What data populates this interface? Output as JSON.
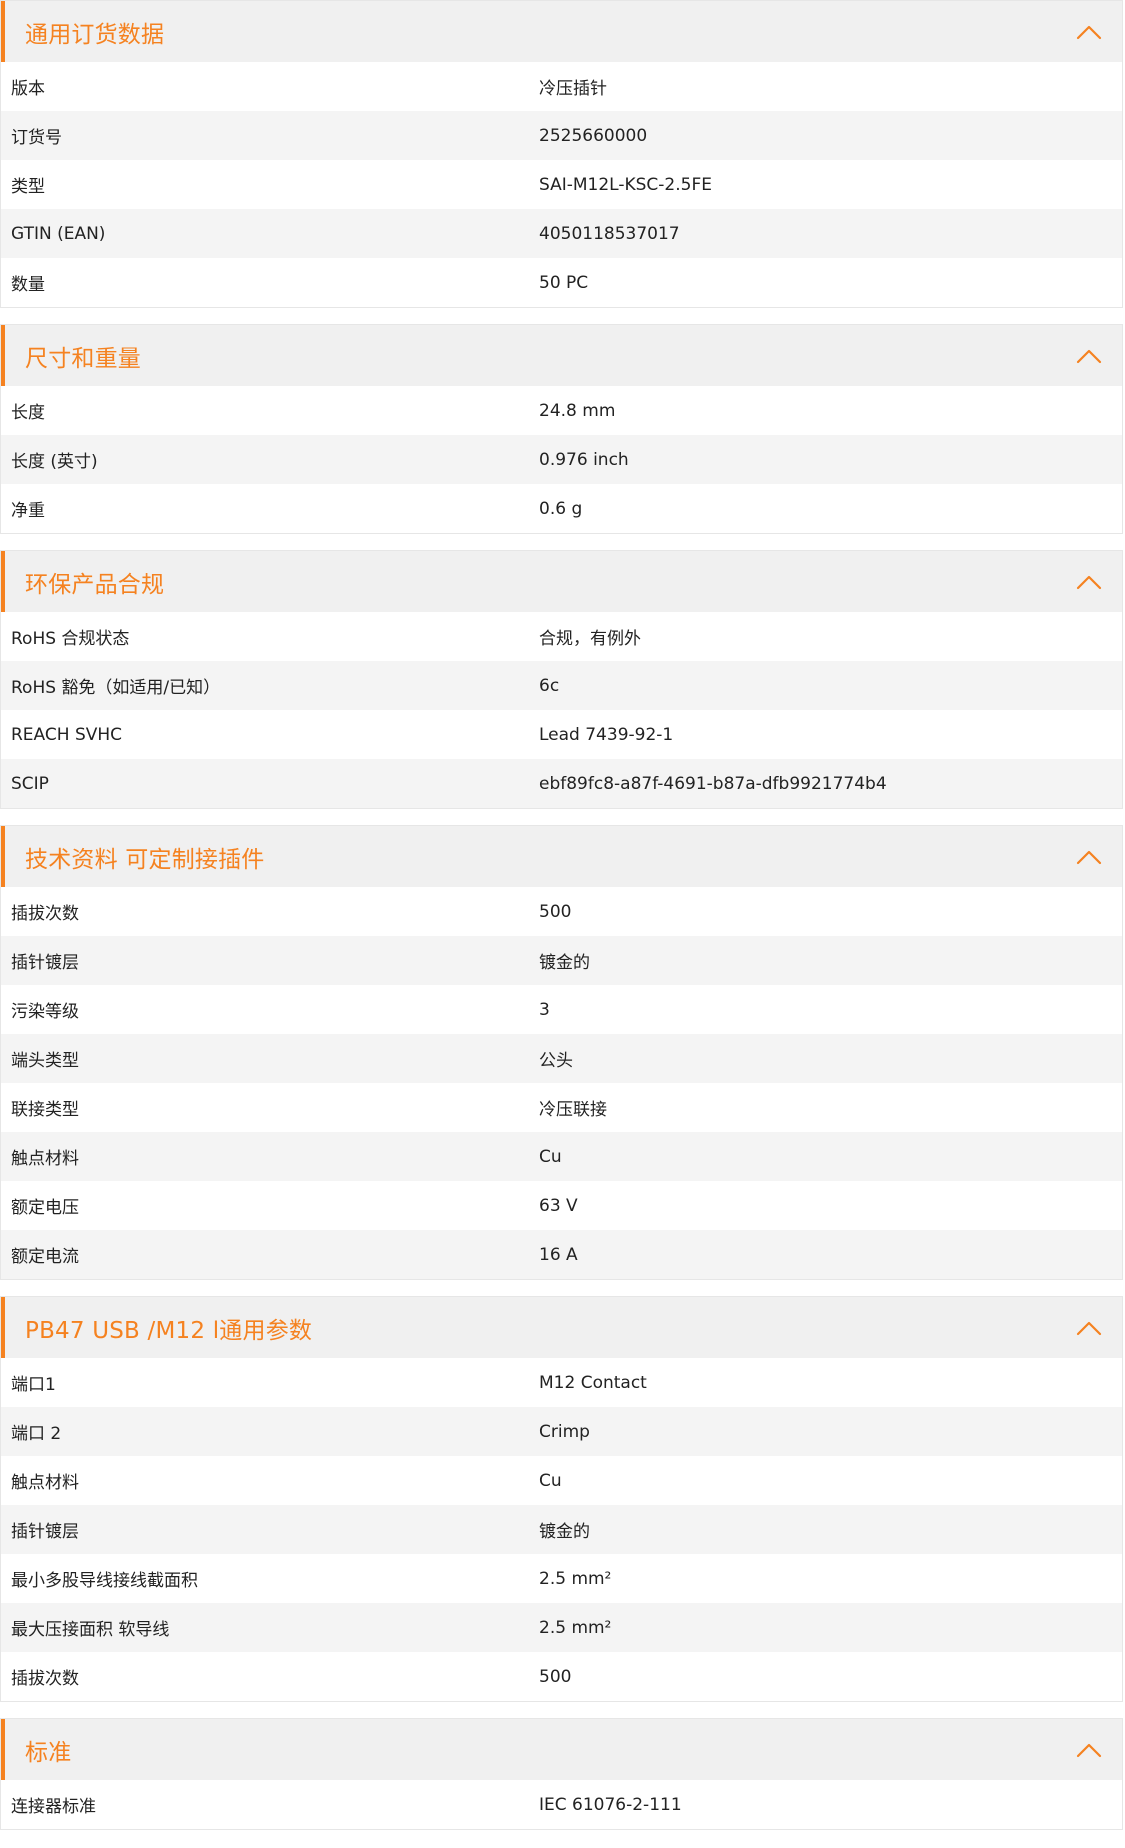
{
  "colors": {
    "accent": "#f58220",
    "header_bg": "#f0f0f0",
    "row_alt_bg": "#f4f4f4"
  },
  "icons": {
    "collapse": "chevron-up-icon"
  },
  "sections": [
    {
      "title": "通用订货数据",
      "rows": [
        {
          "label": "版本",
          "value": "冷压插针"
        },
        {
          "label": "订货号",
          "value": "2525660000"
        },
        {
          "label": "类型",
          "value": "SAI-M12L-KSC-2.5FE"
        },
        {
          "label": "GTIN (EAN)",
          "value": "4050118537017"
        },
        {
          "label": "数量",
          "value": "50  PC"
        }
      ]
    },
    {
      "title": "尺寸和重量",
      "rows": [
        {
          "label": "长度",
          "value": "24.8  mm"
        },
        {
          "label": "长度 (英寸)",
          "value": "0.976  inch"
        },
        {
          "label": "净重",
          "value": "0.6  g"
        }
      ]
    },
    {
      "title": "环保产品合规",
      "rows": [
        {
          "label": "RoHS 合规状态",
          "value": "合规，有例外"
        },
        {
          "label": "RoHS 豁免（如适用/已知）",
          "value": "6c"
        },
        {
          "label": "REACH SVHC",
          "value": "Lead 7439-92-1"
        },
        {
          "label": "SCIP",
          "value": "ebf89fc8-a87f-4691-b87a-dfb9921774b4"
        }
      ]
    },
    {
      "title": "技术资料 可定制接插件",
      "rows": [
        {
          "label": "插拔次数",
          "value": "500"
        },
        {
          "label": "插针镀层",
          "value": "镀金的"
        },
        {
          "label": "污染等级",
          "value": "3"
        },
        {
          "label": "端头类型",
          "value": "公头"
        },
        {
          "label": "联接类型",
          "value": "冷压联接"
        },
        {
          "label": "触点材料",
          "value": "Cu"
        },
        {
          "label": "额定电压",
          "value": "63  V"
        },
        {
          "label": "额定电流",
          "value": "16  A"
        }
      ]
    },
    {
      "title": "PB47 USB /M12 l通用参数",
      "rows": [
        {
          "label": "端口1",
          "value": "M12 Contact"
        },
        {
          "label": "端口 2",
          "value": "Crimp"
        },
        {
          "label": "触点材料",
          "value": "Cu"
        },
        {
          "label": "插针镀层",
          "value": "镀金的"
        },
        {
          "label": "最小多股导线接线截面积",
          "value": "2.5  mm²"
        },
        {
          "label": "最大压接面积 软导线",
          "value": "2.5  mm²"
        },
        {
          "label": "插拔次数",
          "value": "500"
        }
      ]
    },
    {
      "title": "标准",
      "rows": [
        {
          "label": "连接器标准",
          "value": "IEC 61076-2-111"
        }
      ]
    }
  ]
}
